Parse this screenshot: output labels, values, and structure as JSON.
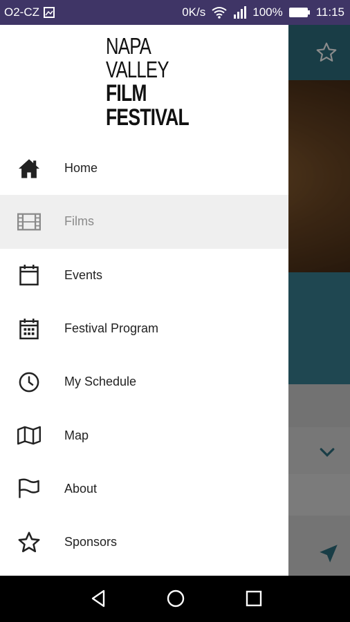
{
  "status_bar": {
    "carrier": "O2-CZ",
    "network_speed": "0K/s",
    "battery": "100%",
    "time": "11:15"
  },
  "logo": {
    "line1": "NAPA",
    "line2": "VALLEY",
    "line3": "FILM",
    "line4": "FESTIVAL"
  },
  "menu": {
    "items": [
      {
        "label": "Home",
        "icon": "home-icon"
      },
      {
        "label": "Films",
        "icon": "film-icon",
        "selected": true
      },
      {
        "label": "Events",
        "icon": "calendar-icon"
      },
      {
        "label": "Festival Program",
        "icon": "calendar-grid-icon"
      },
      {
        "label": "My Schedule",
        "icon": "clock-icon"
      },
      {
        "label": "Map",
        "icon": "map-icon"
      },
      {
        "label": "About",
        "icon": "flag-icon"
      },
      {
        "label": "Sponsors",
        "icon": "star-icon"
      }
    ]
  },
  "colors": {
    "status_bar": "#3f3566",
    "toolbar": "#2f6f80",
    "selected_item": "#efefef"
  }
}
